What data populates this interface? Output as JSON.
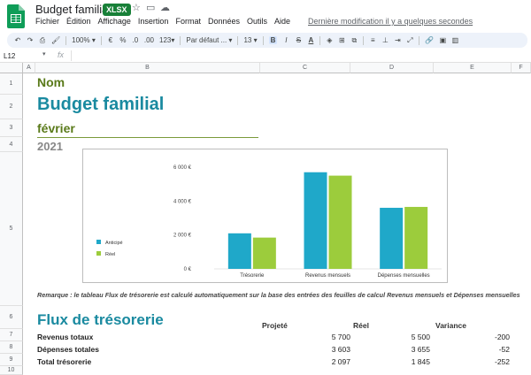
{
  "app": {
    "doc_title": "Budget familial",
    "badge": "XLSX",
    "menu": [
      "Fichier",
      "Édition",
      "Affichage",
      "Insertion",
      "Format",
      "Données",
      "Outils",
      "Aide"
    ],
    "last_modified": "Dernière modification il y a quelques secondes"
  },
  "toolbar": {
    "zoom": "100%",
    "currency": "€",
    "percent": "%",
    "dec_decrease": ".0",
    "dec_increase": ".00",
    "more_formats": "123",
    "font": "Par défaut ...",
    "font_size": "13",
    "bold": "B",
    "italic": "I",
    "strike": "S",
    "text_color": "A"
  },
  "formula_bar": {
    "name_box": "L12",
    "fx": "fx",
    "value": ""
  },
  "columns": [
    "A",
    "B",
    "C",
    "D",
    "E",
    "F"
  ],
  "rows": [
    "1",
    "2",
    "3",
    "4",
    "5",
    "6",
    "7",
    "8",
    "9",
    "10"
  ],
  "sheet": {
    "name_label": "Nom",
    "title": "Budget familial",
    "month": "février",
    "year": "2021",
    "remark": "Remarque : le tableau Flux de trésorerie est calculé automatiquement sur la base des entrées des feuilles de calcul Revenus mensuels et Dépenses mensuelles",
    "flux_title": "Flux de trésorerie",
    "headers": {
      "projected": "Projeté",
      "actual": "Réel",
      "variance": "Variance"
    },
    "table": [
      {
        "label": "Revenus totaux",
        "projected": "5 700",
        "actual": "5 500",
        "variance": "-200"
      },
      {
        "label": "Dépenses totales",
        "projected": "3 603",
        "actual": "3 655",
        "variance": "-52"
      },
      {
        "label": "Total trésorerie",
        "projected": "2 097",
        "actual": "1 845",
        "variance": "-252"
      }
    ]
  },
  "chart_data": {
    "type": "bar",
    "categories": [
      "Trésorerie",
      "Revenus mensuels",
      "Dépenses mensuelles"
    ],
    "series": [
      {
        "name": "Anticipé",
        "color": "#1fa8c9",
        "values": [
          2097,
          5700,
          3603
        ]
      },
      {
        "name": "Réel",
        "color": "#9ccc3c",
        "values": [
          1845,
          5500,
          3655
        ]
      }
    ],
    "yticks": [
      "0 €",
      "2 000 €",
      "4 000 €",
      "6 000 €"
    ],
    "ylim": [
      0,
      6000
    ],
    "legend": "left"
  }
}
